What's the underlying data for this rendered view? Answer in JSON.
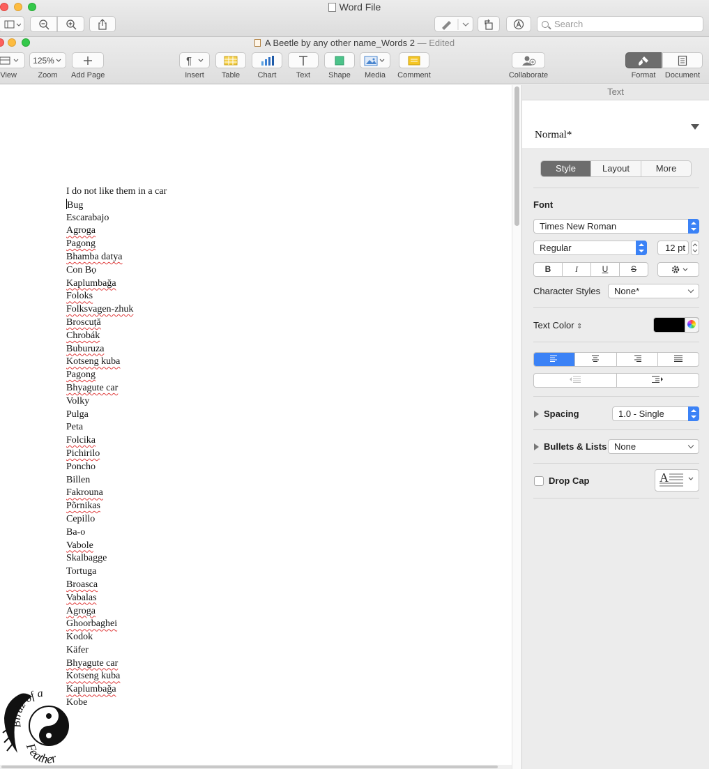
{
  "app_window": {
    "title": "Word File",
    "search_placeholder": "Search"
  },
  "pages_window": {
    "doc_title": "A Beetle by any other name_Words 2",
    "edited_label": "— Edited",
    "toolbar": {
      "view": "View",
      "zoom_value": "125%",
      "zoom": "Zoom",
      "add_page": "Add Page",
      "insert": "Insert",
      "table": "Table",
      "chart": "Chart",
      "text": "Text",
      "shape": "Shape",
      "media": "Media",
      "comment": "Comment",
      "collaborate": "Collaborate",
      "format": "Format",
      "document": "Document"
    }
  },
  "document": {
    "lines": [
      {
        "text": "I do not like them in a car",
        "misspelled": false
      },
      {
        "text": "Bug",
        "misspelled": false,
        "cursor": true
      },
      {
        "text": "Escarabajo",
        "misspelled": false
      },
      {
        "text": "Agroga",
        "misspelled": true
      },
      {
        "text": "Pagong",
        "misspelled": true
      },
      {
        "text": "Bhamba datya",
        "misspelled": true
      },
      {
        "text": "Con Bọ",
        "misspelled": false
      },
      {
        "text": "Kaplumbağa",
        "misspelled": true
      },
      {
        "text": "Foloks",
        "misspelled": true
      },
      {
        "text": "Folksvagen-zhuk",
        "misspelled": true
      },
      {
        "text": "Broscuță",
        "misspelled": true
      },
      {
        "text": "Chrobák",
        "misspelled": true
      },
      {
        "text": "Buburuza",
        "misspelled": true
      },
      {
        "text": "Kotseng kuba",
        "misspelled": true
      },
      {
        "text": "Pagong",
        "misspelled": true
      },
      {
        "text": "Bhyagute car",
        "misspelled": true
      },
      {
        "text": "Volky",
        "misspelled": false
      },
      {
        "text": "Pulga",
        "misspelled": false
      },
      {
        "text": "Peta",
        "misspelled": false
      },
      {
        "text": "Folcika",
        "misspelled": true
      },
      {
        "text": "Pichirilo",
        "misspelled": true
      },
      {
        "text": "Poncho",
        "misspelled": false
      },
      {
        "text": "Billen",
        "misspelled": false
      },
      {
        "text": "Fakrouna",
        "misspelled": true
      },
      {
        "text": "Põrnikas",
        "misspelled": true
      },
      {
        "text": "Cepillo",
        "misspelled": false
      },
      {
        "text": "Ba-o",
        "misspelled": false
      },
      {
        "text": "Vabole",
        "misspelled": true
      },
      {
        "text": "Skalbagge",
        "misspelled": false
      },
      {
        "text": "Tortuga",
        "misspelled": false
      },
      {
        "text": "Broasca",
        "misspelled": true
      },
      {
        "text": "Vabalas",
        "misspelled": true
      },
      {
        "text": "Agroga",
        "misspelled": true
      },
      {
        "text": "Ghoorbaghei",
        "misspelled": true
      },
      {
        "text": "Kodok",
        "misspelled": false
      },
      {
        "text": "Käfer",
        "misspelled": false
      },
      {
        "text": "Bhyagute car",
        "misspelled": true
      },
      {
        "text": "Kotseng kuba",
        "misspelled": true
      },
      {
        "text": "Kaplumbağa",
        "misspelled": true
      },
      {
        "text": "Kobe",
        "misspelled": false
      }
    ],
    "logo_text_top": "Birdz of a",
    "logo_text_bottom": "Feather"
  },
  "inspector": {
    "header": "Text",
    "paragraph_style": "Normal*",
    "tabs": [
      "Style",
      "Layout",
      "More"
    ],
    "font_heading": "Font",
    "font_family": "Times New Roman",
    "font_weight": "Regular",
    "font_size": "12 pt",
    "bold": "B",
    "italic": "I",
    "underline": "U",
    "strikethrough": "S",
    "character_styles_label": "Character Styles",
    "character_styles_value": "None*",
    "text_color_label": "Text Color",
    "text_color": "#000000",
    "spacing_label": "Spacing",
    "spacing_value": "1.0 - Single",
    "bullets_label": "Bullets & Lists",
    "bullets_value": "None",
    "drop_cap_label": "Drop Cap",
    "accent_color": "#3b82f6"
  }
}
